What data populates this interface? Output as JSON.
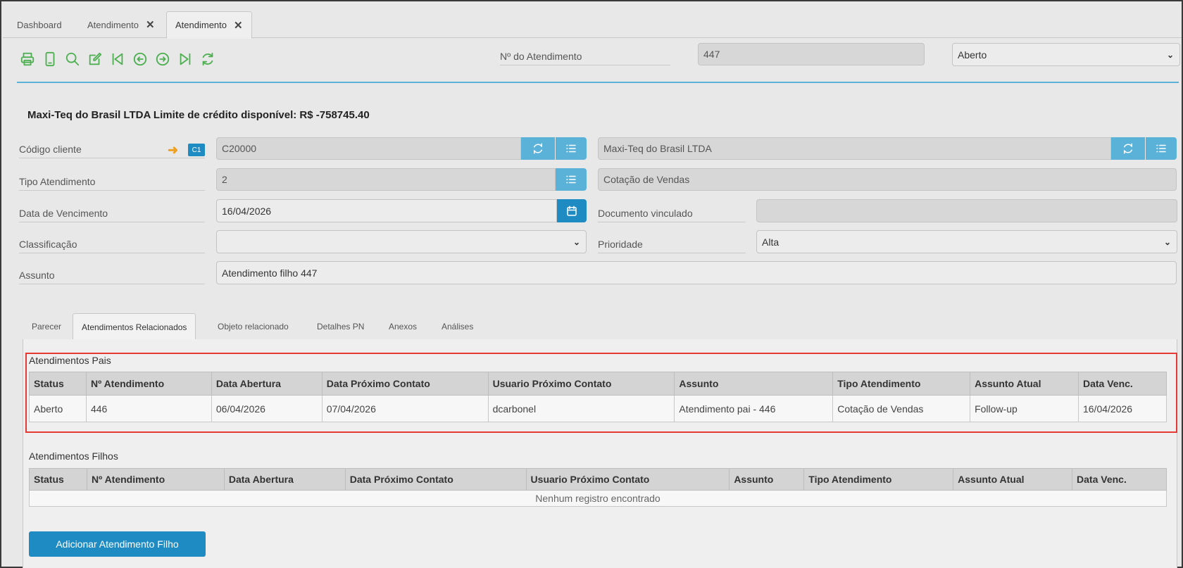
{
  "doc_tabs": [
    {
      "label": "Dashboard",
      "closable": false
    },
    {
      "label": "Atendimento",
      "closable": true
    },
    {
      "label": "Atendimento",
      "closable": true,
      "active": true
    }
  ],
  "close_glyph": "✕",
  "toolbar": {
    "icons": [
      "print-icon",
      "mobile-icon",
      "search-icon",
      "edit-icon",
      "first-icon",
      "previous-icon",
      "next-icon",
      "last-icon",
      "refresh-icon"
    ]
  },
  "header": {
    "numero_label": "Nº do Atendimento",
    "numero_value": "447",
    "status_value": "Aberto"
  },
  "headline": "Maxi-Teq do Brasil LTDA Limite de crédito disponível: R$ -758745.40",
  "form": {
    "codigo_cliente_label": "Código cliente",
    "codigo_badge": "C1",
    "codigo_cliente_value": "C20000",
    "cliente_nome_value": "Maxi-Teq do Brasil LTDA",
    "tipo_label": "Tipo Atendimento",
    "tipo_value": "2",
    "tipo_desc_value": "Cotação de Vendas",
    "vencimento_label": "Data de Vencimento",
    "vencimento_value": "16/04/2026",
    "doc_vinculado_label": "Documento vinculado",
    "doc_vinculado_value": "",
    "classificacao_label": "Classificação",
    "classificacao_value": "",
    "prioridade_label": "Prioridade",
    "prioridade_value": "Alta",
    "assunto_label": "Assunto",
    "assunto_value": "Atendimento filho 447"
  },
  "inner_tabs": [
    "Parecer",
    "Atendimentos Relacionados",
    "Objeto relacionado",
    "Detalhes PN",
    "Anexos",
    "Análises"
  ],
  "pais": {
    "title": "Atendimentos Pais",
    "columns": [
      "Status",
      "Nº Atendimento",
      "Data Abertura",
      "Data Próximo Contato",
      "Usuario Próximo Contato",
      "Assunto",
      "Tipo Atendimento",
      "Assunto Atual",
      "Data Venc."
    ],
    "rows": [
      [
        "Aberto",
        "446",
        "06/04/2026",
        "07/04/2026",
        "dcarbonel",
        "Atendimento pai - 446",
        "Cotação de Vendas",
        "Follow-up",
        "16/04/2026"
      ]
    ]
  },
  "filhos": {
    "title": "Atendimentos Filhos",
    "columns": [
      "Status",
      "Nº Atendimento",
      "Data Abertura",
      "Data Próximo Contato",
      "Usuario Próximo Contato",
      "Assunto",
      "Tipo Atendimento",
      "Assunto Atual",
      "Data Venc."
    ],
    "empty_text": "Nenhum registro encontrado"
  },
  "add_button_label": "Adicionar Atendimento Filho",
  "colors": {
    "accent": "#5bb2d8",
    "primary_button": "#1e8bc3",
    "toolbar_icon": "#4caf50",
    "arrow": "#f0a020",
    "highlight": "#e53935"
  }
}
